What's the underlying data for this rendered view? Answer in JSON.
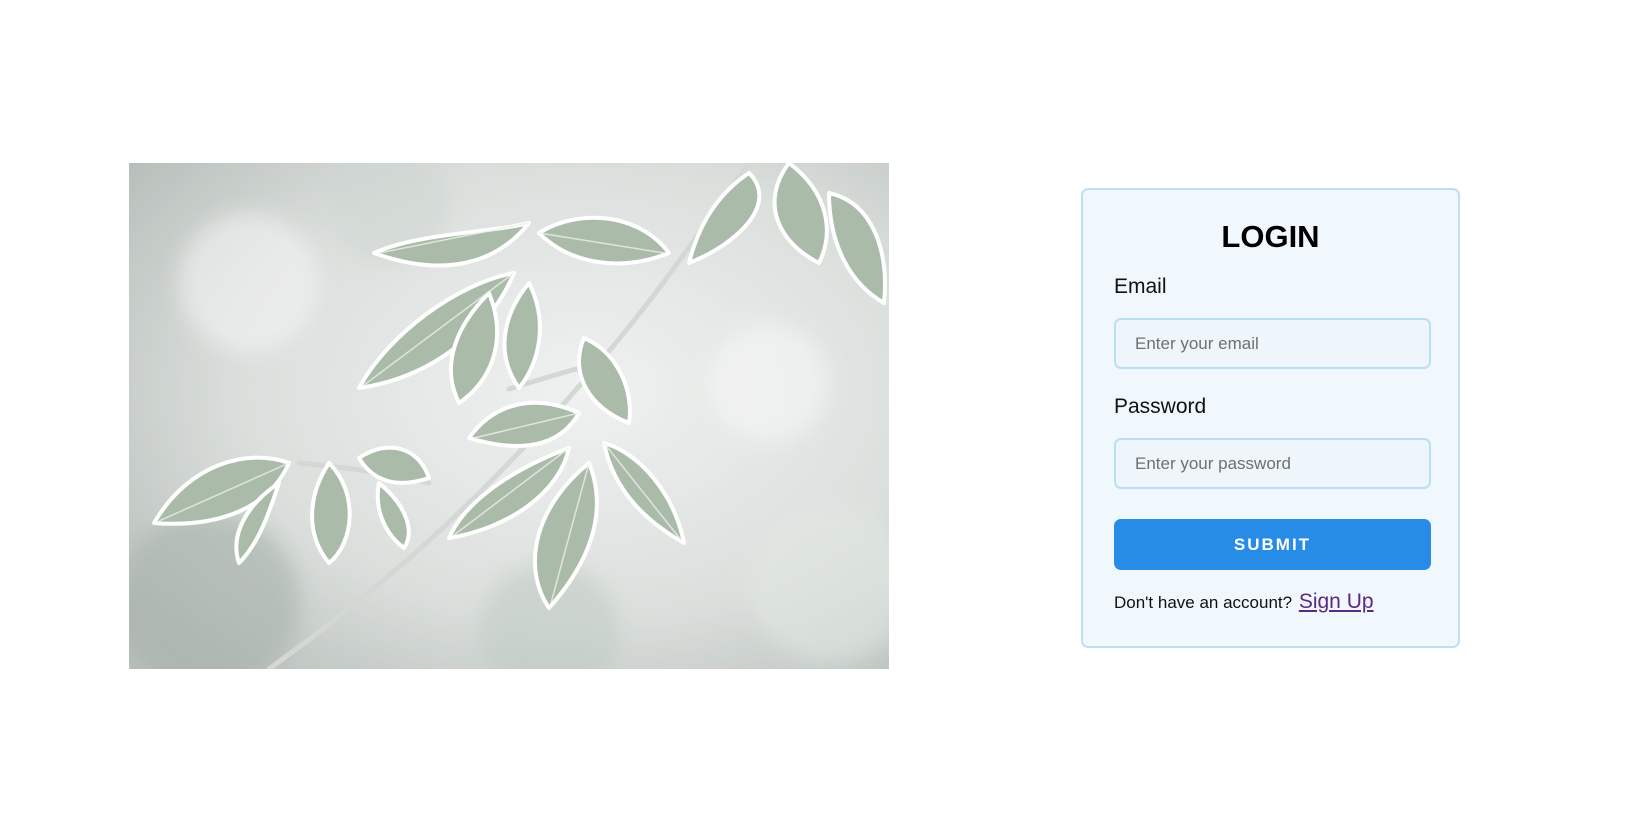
{
  "hero_image": {
    "icon": "frosted-leaves-photo"
  },
  "login": {
    "title": "LOGIN",
    "email_label": "Email",
    "email_placeholder": "Enter your email",
    "email_value": "",
    "password_label": "Password",
    "password_placeholder": "Enter your password",
    "password_value": "",
    "submit_label": "SUBMIT",
    "signup_prompt": "Don't have an account?",
    "signup_link": "Sign Up"
  },
  "colors": {
    "card_background": "#f0f7fd",
    "card_border": "#bfe0f3",
    "input_border": "#b9dff2",
    "button": "#268ce6",
    "link": "#5a2a82"
  }
}
